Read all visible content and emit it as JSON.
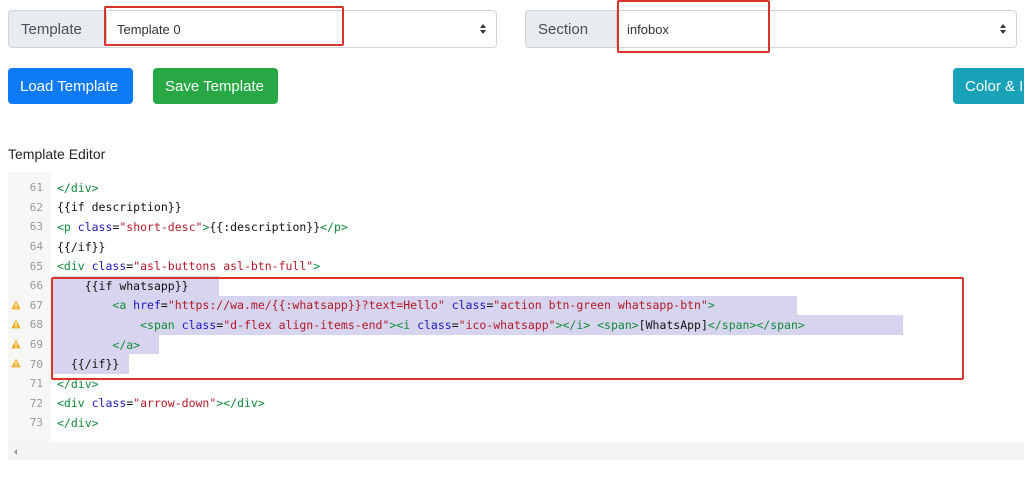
{
  "template_select": {
    "label": "Template",
    "value": "Template 0"
  },
  "section_select": {
    "label": "Section",
    "value": "infobox"
  },
  "buttons": {
    "load": "Load Template",
    "save": "Save Template",
    "color": "Color & I"
  },
  "editor": {
    "label": "Template Editor",
    "lines": [
      {
        "num": "61",
        "warn": false,
        "indent": "",
        "tokens": [
          {
            "t": "tag",
            "v": "</div>"
          }
        ]
      },
      {
        "num": "62",
        "warn": false,
        "indent": "",
        "tokens": [
          {
            "t": "plain",
            "v": "{{if description}}"
          }
        ]
      },
      {
        "num": "63",
        "warn": false,
        "indent": "",
        "tokens": [
          {
            "t": "tag",
            "v": "<p "
          },
          {
            "t": "attr",
            "v": "class"
          },
          {
            "t": "plain",
            "v": "="
          },
          {
            "t": "str",
            "v": "\"short-desc\""
          },
          {
            "t": "tag",
            "v": ">"
          },
          {
            "t": "plain",
            "v": "{{:description}}"
          },
          {
            "t": "tag",
            "v": "</p>"
          }
        ]
      },
      {
        "num": "64",
        "warn": false,
        "indent": "",
        "tokens": [
          {
            "t": "plain",
            "v": "{{/if}}"
          }
        ]
      },
      {
        "num": "65",
        "warn": false,
        "indent": "",
        "tokens": [
          {
            "t": "tag",
            "v": "<div "
          },
          {
            "t": "attr",
            "v": "class"
          },
          {
            "t": "plain",
            "v": "="
          },
          {
            "t": "str",
            "v": "\"asl-buttons asl-btn-full\""
          },
          {
            "t": "tag",
            "v": ">"
          }
        ]
      },
      {
        "num": "66",
        "warn": false,
        "indent": "    ",
        "tokens": [
          {
            "t": "plain",
            "v": "{{if whatsapp}}"
          }
        ]
      },
      {
        "num": "67",
        "warn": true,
        "indent": "        ",
        "tokens": [
          {
            "t": "tag",
            "v": "<a "
          },
          {
            "t": "attr",
            "v": "href"
          },
          {
            "t": "plain",
            "v": "="
          },
          {
            "t": "str",
            "v": "\"https://wa.me/{{:whatsapp}}?text=Hello\""
          },
          {
            "t": "plain",
            "v": " "
          },
          {
            "t": "attr",
            "v": "class"
          },
          {
            "t": "plain",
            "v": "="
          },
          {
            "t": "str",
            "v": "\"action btn-green whatsapp-btn\""
          },
          {
            "t": "tag",
            "v": ">"
          }
        ]
      },
      {
        "num": "68",
        "warn": true,
        "indent": "            ",
        "tokens": [
          {
            "t": "tag",
            "v": "<span "
          },
          {
            "t": "attr",
            "v": "class"
          },
          {
            "t": "plain",
            "v": "="
          },
          {
            "t": "str",
            "v": "\"d-flex align-items-end\""
          },
          {
            "t": "tag",
            "v": "><i "
          },
          {
            "t": "attr",
            "v": "class"
          },
          {
            "t": "plain",
            "v": "="
          },
          {
            "t": "str",
            "v": "\"ico-whatsapp\""
          },
          {
            "t": "tag",
            "v": "></i> <span>"
          },
          {
            "t": "plain",
            "v": "[WhatsApp]"
          },
          {
            "t": "tag",
            "v": "</span></span>"
          }
        ]
      },
      {
        "num": "69",
        "warn": true,
        "indent": "        ",
        "tokens": [
          {
            "t": "tag",
            "v": "</a>"
          }
        ]
      },
      {
        "num": "70",
        "warn": true,
        "indent": "  ",
        "tokens": [
          {
            "t": "plain",
            "v": "{{/if}}"
          }
        ]
      },
      {
        "num": "71",
        "warn": false,
        "indent": "",
        "tokens": [
          {
            "t": "tag",
            "v": "</div>"
          }
        ]
      },
      {
        "num": "72",
        "warn": false,
        "indent": "",
        "tokens": [
          {
            "t": "tag",
            "v": "<div "
          },
          {
            "t": "attr",
            "v": "class"
          },
          {
            "t": "plain",
            "v": "="
          },
          {
            "t": "str",
            "v": "\"arrow-down\""
          },
          {
            "t": "tag",
            "v": "></div>"
          }
        ]
      },
      {
        "num": "73",
        "warn": false,
        "indent": "",
        "tokens": [
          {
            "t": "tag",
            "v": "</div>"
          }
        ]
      }
    ]
  },
  "colors": {
    "primary": "#0d7bf7",
    "success": "#28a745",
    "info": "#17a2b8",
    "highlight": "#d9332e",
    "selection": "#d7d4f0"
  }
}
